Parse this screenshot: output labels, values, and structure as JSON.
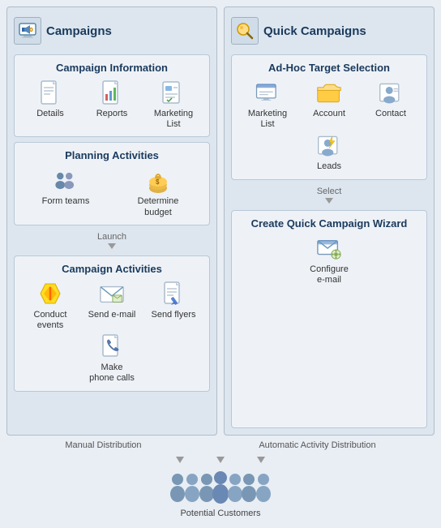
{
  "leftCol": {
    "title": "Campaigns",
    "campaignInfo": {
      "title": "Campaign Information",
      "items": [
        {
          "label": "Details",
          "icon": "document-icon"
        },
        {
          "label": "Reports",
          "icon": "report-icon"
        },
        {
          "label": "Marketing List",
          "icon": "marketing-list-icon"
        }
      ]
    },
    "planningActivities": {
      "title": "Planning Activities",
      "items": [
        {
          "label": "Form teams",
          "icon": "teams-icon"
        },
        {
          "label": "Determine budget",
          "icon": "budget-icon"
        }
      ]
    },
    "launchLabel": "Launch",
    "campaignActivities": {
      "title": "Campaign Activities",
      "items": [
        {
          "label": "Conduct events",
          "icon": "events-icon"
        },
        {
          "label": "Send e-mail",
          "icon": "email-icon"
        },
        {
          "label": "Send flyers",
          "icon": "flyers-icon"
        },
        {
          "label": "Make phone calls",
          "icon": "phone-icon"
        }
      ]
    }
  },
  "rightCol": {
    "title": "Quick Campaigns",
    "adHoc": {
      "title": "Ad-Hoc Target Selection",
      "items": [
        {
          "label": "Marketing List",
          "icon": "marketing-list-icon2"
        },
        {
          "label": "Account",
          "icon": "account-icon"
        },
        {
          "label": "Contact",
          "icon": "contact-icon"
        },
        {
          "label": "Leads",
          "icon": "leads-icon"
        }
      ]
    },
    "selectLabel": "Select",
    "wizard": {
      "title": "Create Quick Campaign Wizard",
      "items": [
        {
          "label": "Configure e-mail",
          "icon": "configure-email-icon"
        }
      ]
    }
  },
  "bottom": {
    "leftLabel": "Manual Distribution",
    "rightLabel": "Automatic Activity Distribution",
    "customersLabel": "Potential Customers"
  }
}
